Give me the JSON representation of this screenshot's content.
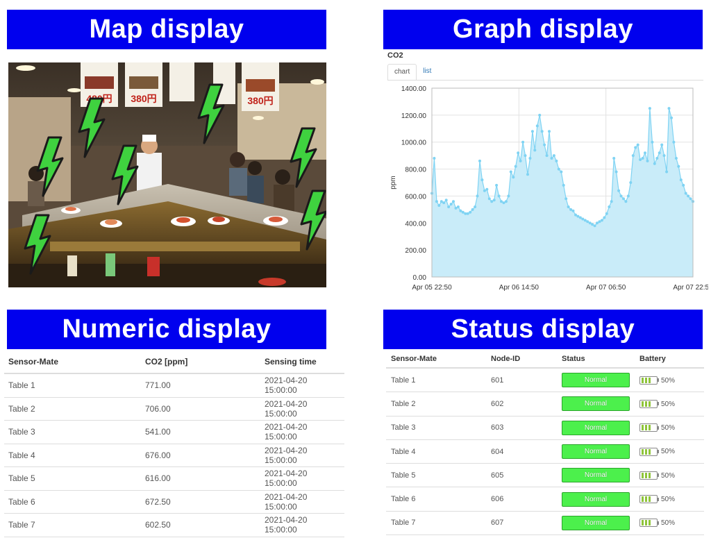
{
  "banners": {
    "map": "Map display",
    "graph": "Graph display",
    "numeric": "Numeric display",
    "status": "Status display"
  },
  "map": {
    "menu_signs": [
      "480円",
      "380円",
      "380円"
    ],
    "sensor_icon": "lightning-bolt-icon",
    "sensor_count": 8
  },
  "graph": {
    "title": "CO2",
    "tabs": [
      {
        "label": "chart",
        "active": true
      },
      {
        "label": "list",
        "active": false
      }
    ]
  },
  "chart_data": {
    "type": "area",
    "title": "CO2",
    "xlabel": "",
    "ylabel": "ppm",
    "ylim": [
      0,
      1400
    ],
    "yticks": [
      "0.00",
      "200.00",
      "400.00",
      "600.00",
      "800.00",
      "1000.00",
      "1200.00",
      "1400.00"
    ],
    "xticks": [
      "Apr 05 22:50",
      "Apr 06 14:50",
      "Apr 07 06:50",
      "Apr 07 22:50"
    ],
    "grid": true,
    "fill_color": "#c9ecf9",
    "line_color": "#7fd3f3",
    "series": [
      {
        "values": [
          620,
          880,
          560,
          530,
          560,
          550,
          570,
          520,
          540,
          560,
          510,
          520,
          490,
          480,
          470,
          470,
          480,
          500,
          520,
          600,
          860,
          720,
          640,
          650,
          580,
          560,
          570,
          680,
          600,
          560,
          550,
          560,
          600,
          780,
          740,
          820,
          920,
          860,
          1000,
          900,
          760,
          880,
          1080,
          940,
          1120,
          1200,
          1080,
          980,
          900,
          1080,
          880,
          900,
          860,
          800,
          780,
          680,
          580,
          520,
          500,
          490,
          460,
          450,
          440,
          430,
          420,
          410,
          400,
          390,
          380,
          400,
          410,
          420,
          440,
          470,
          520,
          560,
          880,
          780,
          640,
          600,
          580,
          560,
          600,
          700,
          900,
          960,
          980,
          870,
          880,
          920,
          860,
          1250,
          1000,
          840,
          880,
          920,
          980,
          900,
          780,
          1250,
          1180,
          1000,
          880,
          820,
          720,
          680,
          620,
          600,
          580,
          560
        ]
      }
    ]
  },
  "numeric": {
    "headers": [
      "Sensor-Mate",
      "CO2 [ppm]",
      "Sensing time"
    ],
    "rows": [
      [
        "Table 1",
        "771.00",
        "2021-04-20 15:00:00"
      ],
      [
        "Table 2",
        "706.00",
        "2021-04-20 15:00:00"
      ],
      [
        "Table 3",
        "541.00",
        "2021-04-20 15:00:00"
      ],
      [
        "Table 4",
        "676.00",
        "2021-04-20 15:00:00"
      ],
      [
        "Table 5",
        "616.00",
        "2021-04-20 15:00:00"
      ],
      [
        "Table 6",
        "672.50",
        "2021-04-20 15:00:00"
      ],
      [
        "Table 7",
        "602.50",
        "2021-04-20 15:00:00"
      ]
    ]
  },
  "status": {
    "headers": [
      "Sensor-Mate",
      "Node-ID",
      "Status",
      "Battery"
    ],
    "rows": [
      {
        "name": "Table 1",
        "node": "601",
        "status": "Normal",
        "battery": "50%"
      },
      {
        "name": "Table 2",
        "node": "602",
        "status": "Normal",
        "battery": "50%"
      },
      {
        "name": "Table 3",
        "node": "603",
        "status": "Normal",
        "battery": "50%"
      },
      {
        "name": "Table 4",
        "node": "604",
        "status": "Normal",
        "battery": "50%"
      },
      {
        "name": "Table 5",
        "node": "605",
        "status": "Normal",
        "battery": "50%"
      },
      {
        "name": "Table 6",
        "node": "606",
        "status": "Normal",
        "battery": "50%"
      },
      {
        "name": "Table 7",
        "node": "607",
        "status": "Normal",
        "battery": "50%"
      }
    ],
    "status_color": "#4cf04c",
    "battery_level": 0.5
  }
}
